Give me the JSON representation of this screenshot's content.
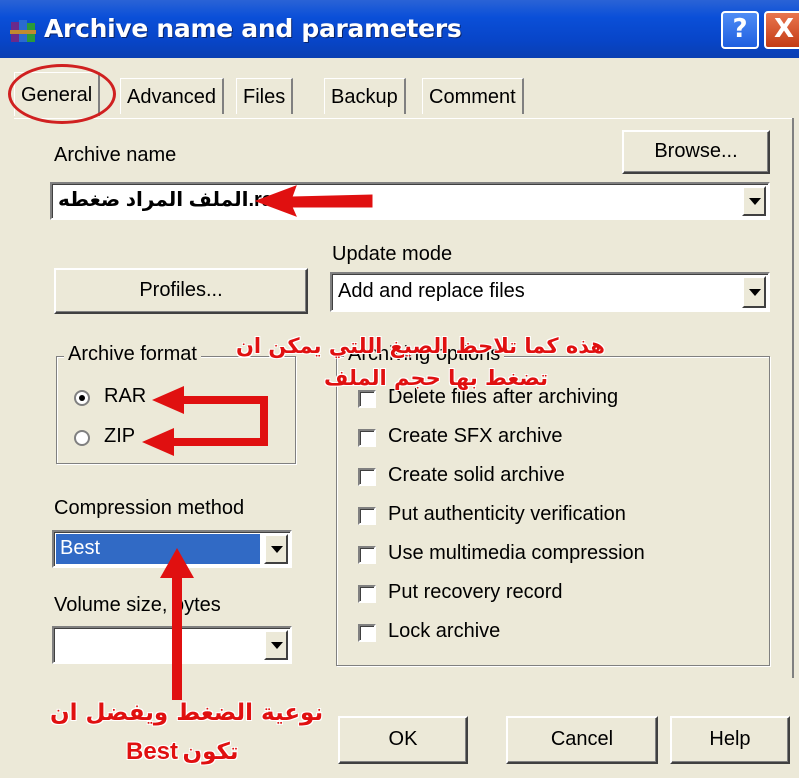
{
  "window": {
    "title": "Archive name and parameters",
    "help_glyph": "?",
    "close_glyph": "X"
  },
  "tabs": [
    {
      "label": "General",
      "active": true
    },
    {
      "label": "Advanced"
    },
    {
      "label": "Files"
    },
    {
      "label": "Backup"
    },
    {
      "label": "Comment"
    }
  ],
  "archive_name": {
    "label": "Archive name",
    "value": "الملف المراد ضغطه.rar",
    "browse_label": "Browse..."
  },
  "profiles_label": "Profiles...",
  "update_mode": {
    "label": "Update mode",
    "value": "Add and replace files"
  },
  "archive_format": {
    "title": "Archive format",
    "options": [
      {
        "label": "RAR",
        "checked": true
      },
      {
        "label": "ZIP",
        "checked": false
      }
    ]
  },
  "archiving_options": {
    "title": "Archiving options",
    "items": [
      {
        "label": "Delete files after archiving"
      },
      {
        "label": "Create SFX archive"
      },
      {
        "label": "Create solid archive"
      },
      {
        "label": "Put authenticity verification"
      },
      {
        "label": "Use multimedia compression"
      },
      {
        "label": "Put recovery record"
      },
      {
        "label": "Lock archive"
      }
    ]
  },
  "compression": {
    "label": "Compression method",
    "value": "Best"
  },
  "volume": {
    "label": "Volume size, bytes",
    "value": ""
  },
  "footer": {
    "ok_label": "OK",
    "cancel_label": "Cancel",
    "help_label": "Help"
  },
  "annotations": {
    "format_note_line1": "هذه كما تلاحظ الصيغ اللتي يمكن ان",
    "format_note_line2": "تضغط بها حجم الملف",
    "compression_note_line1": "نوعية الضغط ويفضل ان",
    "compression_note_line2": "تكون",
    "compression_note_best": "Best",
    "color": "#e01010"
  }
}
